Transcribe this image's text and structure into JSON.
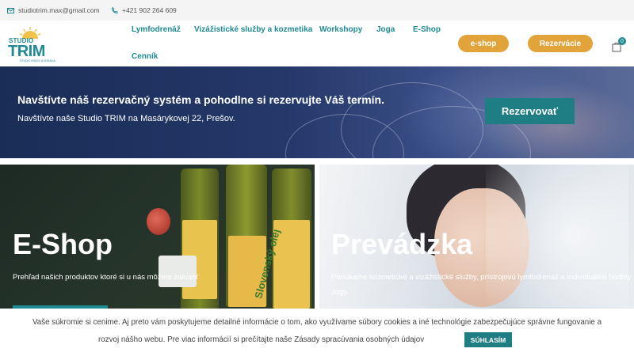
{
  "topbar": {
    "email": "studiotrim.max@gmail.com",
    "phone": "+421 902 264 609"
  },
  "logo": {
    "studio": "STUDIO",
    "name": "TRIM",
    "tagline": "ŠTÚDIO KRÁSY A ZDRAVIA"
  },
  "nav": {
    "items": [
      "Lymfodrenáž",
      "Vizážistické služby a kozmetika",
      "Workshopy",
      "Joga",
      "E-Shop",
      "Cenník"
    ],
    "eshop_button": "e-shop",
    "reservation_button": "Rezervácie",
    "cart_count": "0"
  },
  "banner": {
    "title": "Navštívte náš rezervačný systém a pohodlne si rezervujte Váš termín.",
    "subtitle": "Navštívte naše Studio TRIM na Masárykovej 22, Prešov.",
    "button": "Rezervovať"
  },
  "panels": {
    "eshop": {
      "title": "E-Shop",
      "text": "Prehľad našich produktov ktoré si u nás môžete zakúpiť",
      "label_text": "Slovenský olej"
    },
    "prevadzka": {
      "title": "Prevádzka",
      "text": "Ponúkame kozmetické a vizážistické služby, prístrojovú lymfodrenáž a individuálne hodiny Jógy."
    }
  },
  "cookie": {
    "line1": "Vaše súkromie si cenime. Aj preto vám poskytujeme detailné informácie o tom, ako využívame súbory cookies a iné technológie zabezpečujúce správne fungovanie a",
    "line2": "rozvoj nášho webu. Pre viac informácií si prečítajte naše Zásady spracúvania osobných údajov",
    "accept": "SÚHLASÍM"
  },
  "colors": {
    "brand_teal": "#1f8a92",
    "button_gold": "#e2a33a",
    "dark_teal_button": "#1f7d84"
  }
}
